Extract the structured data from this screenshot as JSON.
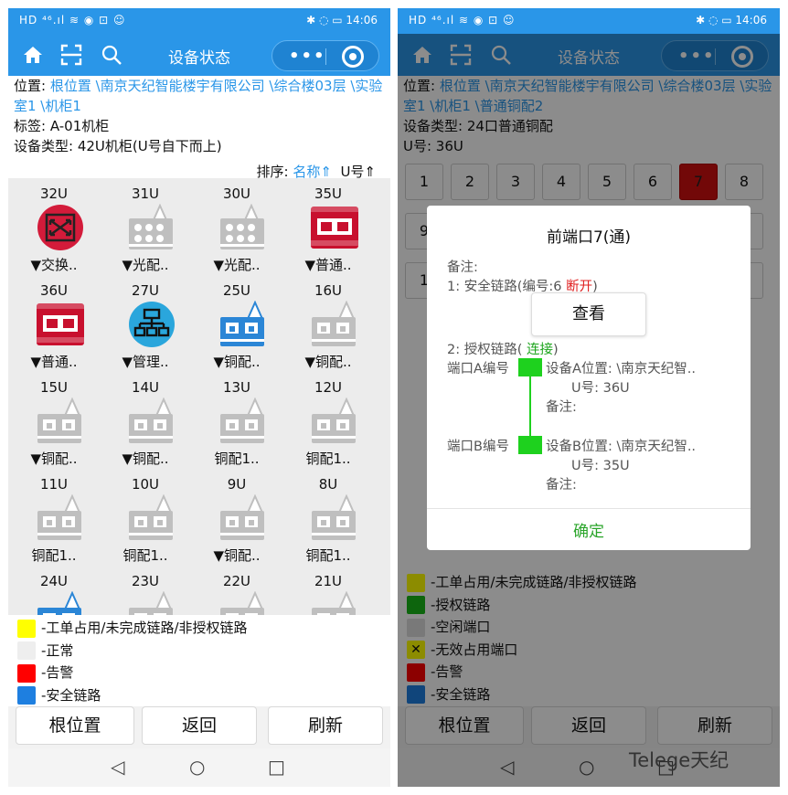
{
  "status": {
    "left": "HD ⁴⁶.ıl ≋ ◉ ⊡ ☺",
    "right": "✱ ◌ ▭ 14:06"
  },
  "left": {
    "nav_title": "设备状态",
    "capsule_dots": "•••",
    "location_label": "位置:",
    "location_path": "根位置 \\南京天纪智能楼宇有限公司 \\综合楼03层 \\实验室1 \\机柜1",
    "tag_line": "标签: A-01机柜",
    "type_line": "设备类型: 42U机柜(U号自下而上)",
    "sort_label": "排序:",
    "sort_name": "名称⇑",
    "sort_u": "U号⇑",
    "cells": [
      {
        "u": "32U",
        "label": "▼交换..",
        "icon": "switch-icon"
      },
      {
        "u": "31U",
        "label": "▼光配..",
        "icon": "fiber-patch-icon"
      },
      {
        "u": "30U",
        "label": "▼光配..",
        "icon": "fiber-patch-icon"
      },
      {
        "u": "35U",
        "label": "▼普通..",
        "icon": "patch-panel-alarm-icon"
      },
      {
        "u": "36U",
        "label": "▼普通..",
        "icon": "patch-panel-alarm-icon"
      },
      {
        "u": "27U",
        "label": "▼管理..",
        "icon": "management-icon"
      },
      {
        "u": "25U",
        "label": "▼铜配..",
        "icon": "copper-patch-secure-icon"
      },
      {
        "u": "16U",
        "label": "▼铜配..",
        "icon": "copper-patch-icon"
      },
      {
        "u": "15U",
        "label": "▼铜配..",
        "icon": "copper-patch-icon"
      },
      {
        "u": "14U",
        "label": "▼铜配..",
        "icon": "copper-patch-icon"
      },
      {
        "u": "13U",
        "label": "铜配1..",
        "icon": "copper-patch-icon"
      },
      {
        "u": "12U",
        "label": "铜配1..",
        "icon": "copper-patch-icon"
      },
      {
        "u": "11U",
        "label": "铜配1..",
        "icon": "copper-patch-icon"
      },
      {
        "u": "10U",
        "label": "铜配1..",
        "icon": "copper-patch-icon"
      },
      {
        "u": "9U",
        "label": "▼铜配..",
        "icon": "copper-patch-icon"
      },
      {
        "u": "8U",
        "label": "铜配1..",
        "icon": "copper-patch-icon"
      },
      {
        "u": "24U",
        "label": "",
        "icon": "copper-patch-secure-icon"
      },
      {
        "u": "23U",
        "label": "",
        "icon": "copper-patch-icon"
      },
      {
        "u": "22U",
        "label": "",
        "icon": "copper-patch-icon"
      },
      {
        "u": "21U",
        "label": "",
        "icon": "copper-patch-icon"
      }
    ],
    "legend": [
      {
        "text": "-工单占用/未完成链路/非授权链路",
        "color": "#ffff00"
      },
      {
        "text": "-正常",
        "color": "#eeeeee"
      },
      {
        "text": "-告警",
        "color": "#ff0000"
      },
      {
        "text": "-安全链路",
        "color": "#1e7fe0"
      }
    ],
    "buttons": {
      "root": "根位置",
      "back": "返回",
      "refresh": "刷新"
    }
  },
  "right": {
    "nav_title": "设备状态",
    "capsule_dots": "•••",
    "location_label": "位置:",
    "location_path": "根位置 \\南京天纪智能楼宇有限公司 \\综合楼03层 \\实验室1 \\机柜1 \\普通铜配2",
    "type_line": "设备类型: 24口普通铜配",
    "u_line": "U号: 36U",
    "ports_row1": [
      "1",
      "2",
      "3",
      "4",
      "5",
      "6",
      "7",
      "8"
    ],
    "ports_row2": [
      "9",
      "",
      "",
      "",
      "",
      "",
      "",
      "6"
    ],
    "ports_row3": [
      "1",
      "",
      "",
      "",
      "",
      "",
      "",
      "4"
    ],
    "dialog": {
      "title": "前端口7(通)",
      "remark": "备注:",
      "link1": "1: 安全链路(编号:6",
      "link1_state": "断开",
      "link1_close": ")",
      "view_button": "查看",
      "link2": "2: 授权链路(",
      "link2_state": "连接",
      "link2_close": ")",
      "portA_label": "端口A编号",
      "devA_location": "设备A位置: \\南京天纪智..",
      "devA_u": "U号: 36U",
      "devA_remark": "备注:",
      "portB_label": "端口B编号",
      "devB_location": "设备B位置: \\南京天纪智..",
      "devB_u": "U号: 35U",
      "devB_remark": "备注:",
      "ok": "确定"
    },
    "legend": [
      {
        "text": "-工单占用/未完成链路/非授权链路",
        "color": "#ffff00"
      },
      {
        "text": "-授权链路",
        "color": "#18b818"
      },
      {
        "text": "-空闲端口",
        "color": "#dddddd"
      },
      {
        "text": "-无效占用端口",
        "color": "#ffff00",
        "mark": "✕"
      },
      {
        "text": "-告警",
        "color": "#ff0000"
      },
      {
        "text": "-安全链路",
        "color": "#1e7fe0"
      }
    ],
    "buttons": {
      "root": "根位置",
      "back": "返回",
      "refresh": "刷新"
    }
  },
  "sysnav": {
    "back": "◁",
    "home": "○",
    "recent": "□"
  },
  "watermark": "Telege天纪"
}
